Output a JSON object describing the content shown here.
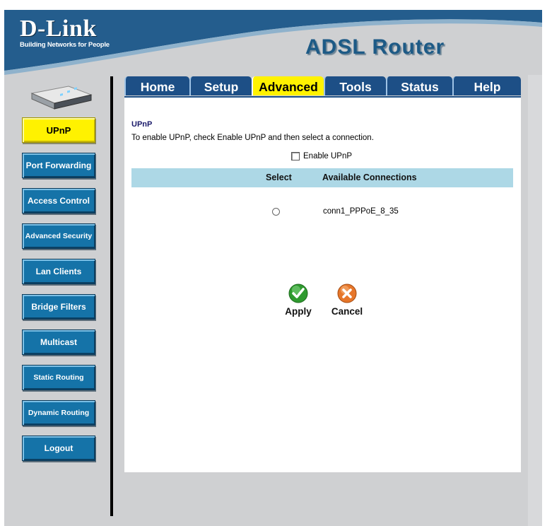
{
  "brand": {
    "name": "D-Link",
    "tagline": "Building Networks for People",
    "product": "ADSL Router"
  },
  "tabs": [
    {
      "label": "Home",
      "active": false
    },
    {
      "label": "Setup",
      "active": false
    },
    {
      "label": "Advanced",
      "active": true
    },
    {
      "label": "Tools",
      "active": false
    },
    {
      "label": "Status",
      "active": false
    },
    {
      "label": "Help",
      "active": false
    }
  ],
  "sidebar": {
    "items": [
      {
        "label": "UPnP",
        "active": true
      },
      {
        "label": "Port Forwarding",
        "active": false
      },
      {
        "label": "Access Control",
        "active": false
      },
      {
        "label": "Advanced Security",
        "active": false
      },
      {
        "label": "Lan Clients",
        "active": false
      },
      {
        "label": "Bridge Filters",
        "active": false
      },
      {
        "label": "Multicast",
        "active": false
      },
      {
        "label": "Static Routing",
        "active": false
      },
      {
        "label": "Dynamic Routing",
        "active": false
      },
      {
        "label": "Logout",
        "active": false
      }
    ]
  },
  "main": {
    "title": "UPnP",
    "instructions": "To enable UPnP, check Enable UPnP and then select a connection.",
    "enable_label": "Enable UPnP",
    "enable_checked": false,
    "table": {
      "headers": [
        "Select",
        "Available Connections"
      ],
      "rows": [
        {
          "selected": false,
          "connection": "conn1_PPPoE_8_35"
        }
      ]
    },
    "apply_label": "Apply",
    "cancel_label": "Cancel"
  },
  "colors": {
    "nav_blue": "#1573a8",
    "tab_blue": "#1d4f86",
    "active_yellow": "#fff200",
    "table_header": "#add8e6",
    "banner_blue": "#2a6a9a"
  }
}
